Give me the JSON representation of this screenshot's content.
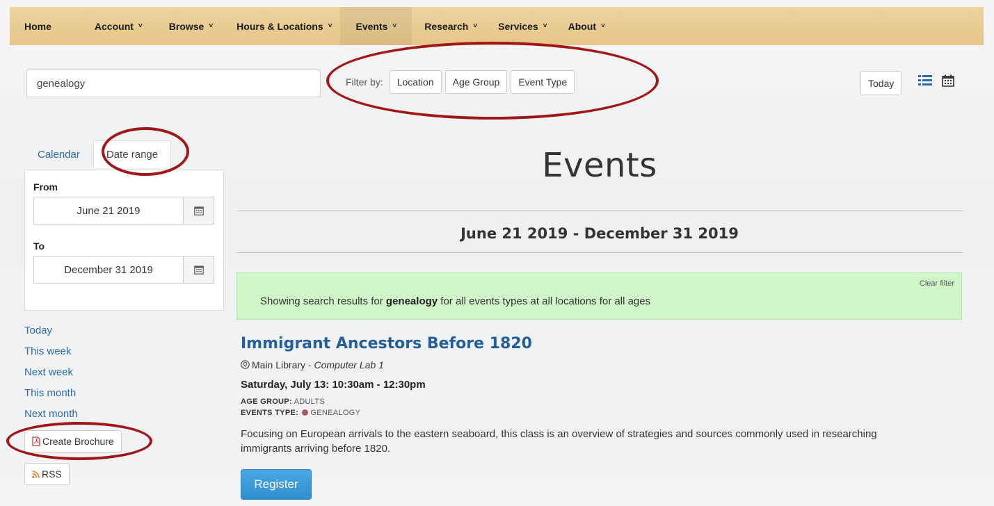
{
  "nav": {
    "items": [
      {
        "label": "Home",
        "dropdown": false
      },
      {
        "label": "Account",
        "dropdown": true
      },
      {
        "label": "Browse",
        "dropdown": true
      },
      {
        "label": "Hours & Locations",
        "dropdown": true
      },
      {
        "label": "Events",
        "dropdown": true
      },
      {
        "label": "Research",
        "dropdown": true
      },
      {
        "label": "Services",
        "dropdown": true
      },
      {
        "label": "About",
        "dropdown": true
      }
    ],
    "chevron": "˅"
  },
  "search": {
    "value": "genealogy"
  },
  "filter": {
    "label": "Filter by:",
    "buttons": [
      "Location",
      "Age Group",
      "Event Type"
    ]
  },
  "toolbar": {
    "today_label": "Today",
    "list_icon": "list-icon",
    "calendar_icon": "calendar-icon"
  },
  "sidebar": {
    "tabs": [
      "Calendar",
      "Date range"
    ],
    "active_tab": "Date range",
    "from_label": "From",
    "from_value": "June 21 2019",
    "to_label": "To",
    "to_value": "December 31 2019",
    "quick_links": [
      "Today",
      "This week",
      "Next week",
      "This month",
      "Next month"
    ],
    "brochure_label": "Create Brochure",
    "rss_label": "RSS"
  },
  "main": {
    "title": "Events",
    "date_range": "June 21 2019 - December 31 2019",
    "alert": {
      "clear_label": "Clear filter",
      "prefix": "Showing search results for ",
      "term": "genealogy",
      "suffix": " for all events types at all locations for all ages"
    }
  },
  "event": {
    "title": "Immigrant Ancestors Before 1820",
    "location": "Main Library",
    "room": "Computer Lab 1",
    "datetime": "Saturday, July 13: 10:30am - 12:30pm",
    "age_label": "AGE GROUP:",
    "age_value": "ADULTS",
    "type_label": "EVENTS TYPE:",
    "type_value": "GENEALOGY",
    "type_color": "#a55c62",
    "description": "Focusing on European arrivals to the eastern seaboard, this class is an overview of strategies and sources commonly used in researching immigrants arriving before 1820.",
    "register_label": "Register"
  },
  "colors": {
    "accent_link": "#2a6ca8",
    "nav_bg": "#e9cc92",
    "alert_bg": "#cff5c8",
    "annotation": "#a11616"
  }
}
